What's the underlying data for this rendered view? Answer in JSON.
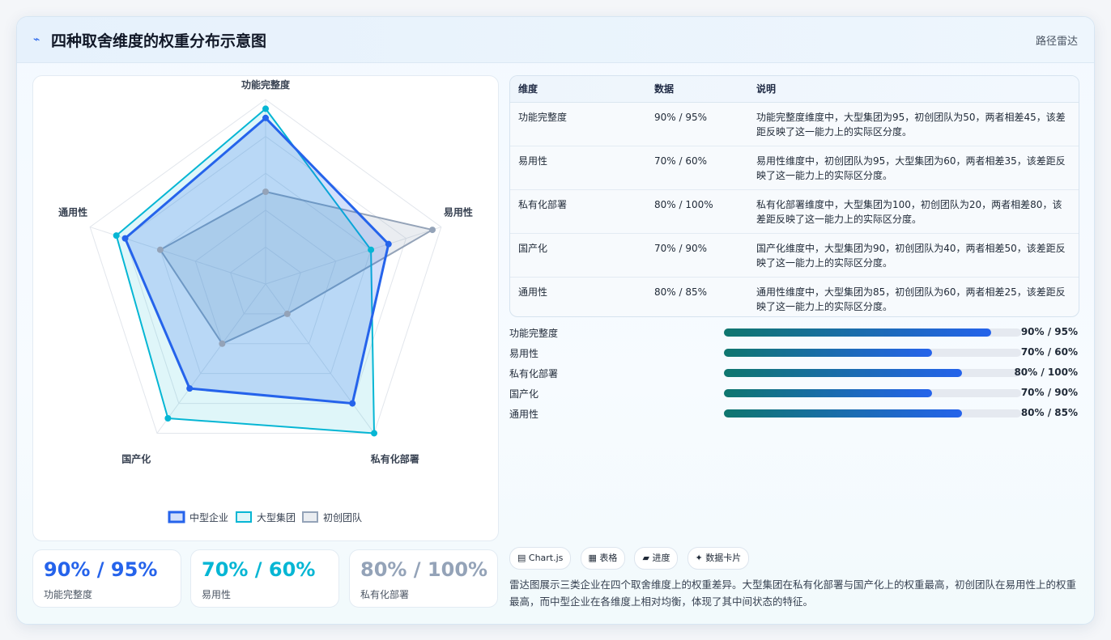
{
  "header": {
    "icon": "chart-line-icon",
    "title": "四种取舍维度的权重分布示意图",
    "source": "路径雷达"
  },
  "colors": {
    "mid": "#2563eb",
    "large": "#06b6d4",
    "startup": "#94a3b8"
  },
  "chart_data": {
    "type": "radar",
    "axes": [
      "功能完整度",
      "易用性",
      "私有化部署",
      "国产化",
      "通用性"
    ],
    "rmax": 100,
    "series": [
      {
        "name": "初创团队",
        "values": [
          50,
          95,
          20,
          40,
          60
        ]
      },
      {
        "name": "大型集团",
        "values": [
          95,
          60,
          100,
          90,
          85
        ]
      },
      {
        "name": "中型企业",
        "values": [
          90,
          70,
          80,
          70,
          80
        ]
      }
    ],
    "legend": [
      "中型企业",
      "大型集团",
      "初创团队"
    ]
  },
  "stats": [
    {
      "value": "90% / 95%",
      "label": "功能完整度",
      "color": "#2563eb"
    },
    {
      "value": "70% / 60%",
      "label": "易用性",
      "color": "#06b6d4"
    },
    {
      "value": "80% / 100%",
      "label": "私有化部署",
      "color": "#94a3b8"
    }
  ],
  "table": {
    "headers": [
      "维度",
      "数据",
      "说明"
    ],
    "rows": [
      [
        "功能完整度",
        "90% / 95%",
        "功能完整度维度中，大型集团为95，初创团队为50，两者相差45，该差距反映了这一能力上的实际区分度。"
      ],
      [
        "易用性",
        "70% / 60%",
        "易用性维度中，初创团队为95，大型集团为60，两者相差35，该差距反映了这一能力上的实际区分度。"
      ],
      [
        "私有化部署",
        "80% / 100%",
        "私有化部署维度中，大型集团为100，初创团队为20，两者相差80，该差距反映了这一能力上的实际区分度。"
      ],
      [
        "国产化",
        "70% / 90%",
        "国产化维度中，大型集团为90，初创团队为40，两者相差50，该差距反映了这一能力上的实际区分度。"
      ],
      [
        "通用性",
        "80% / 85%",
        "通用性维度中，大型集团为85，初创团队为60，两者相差25，该差距反映了这一能力上的实际区分度。"
      ]
    ]
  },
  "bars": [
    {
      "label": "功能完整度",
      "value_text": "90% / 95%",
      "fill": 0.9
    },
    {
      "label": "易用性",
      "value_text": "70% / 60%",
      "fill": 0.7
    },
    {
      "label": "私有化部署",
      "value_text": "80% / 100%",
      "fill": 0.8
    },
    {
      "label": "国产化",
      "value_text": "70% / 90%",
      "fill": 0.7
    },
    {
      "label": "通用性",
      "value_text": "80% / 85%",
      "fill": 0.8
    }
  ],
  "tags": [
    "▤ Chart.js",
    "▦ 表格",
    "▰ 进度",
    "✦ 数据卡片"
  ],
  "summary": "雷达图展示三类企业在四个取舍维度上的权重差异。大型集团在私有化部署与国产化上的权重最高，初创团队在易用性上的权重最高，而中型企业在各维度上相对均衡，体现了其中间状态的特征。"
}
